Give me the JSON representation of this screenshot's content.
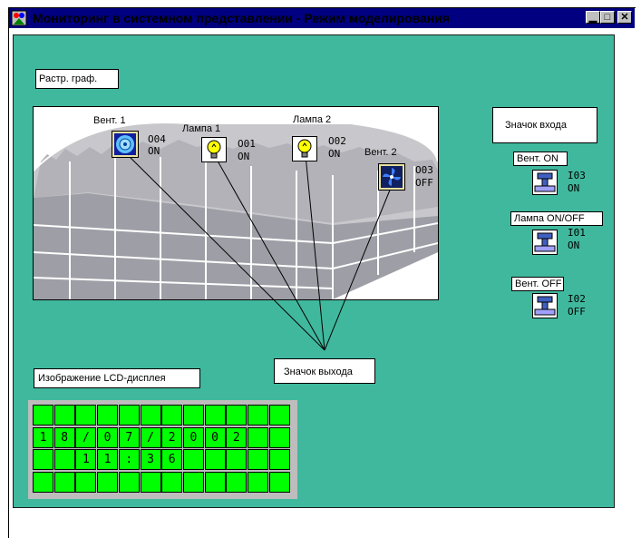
{
  "window": {
    "title": "Мониторинг в системном представлении - Режим моделирования",
    "buttons": {
      "minimize": "▁",
      "maximize": "□",
      "close": "✕"
    }
  },
  "labels": {
    "raster": "Растр. граф.",
    "input_icon": "Значок входа",
    "output_icon": "Значок выхода",
    "lcd_image": "Изображение LCD-дисплея"
  },
  "outputs": [
    {
      "name": "Вент. 1",
      "code": "O04",
      "state": "ON",
      "icon": "fan-icon"
    },
    {
      "name": "Лампа 1",
      "code": "O01",
      "state": "ON",
      "icon": "lamp-icon"
    },
    {
      "name": "Лампа 2",
      "code": "O02",
      "state": "ON",
      "icon": "lamp-icon"
    },
    {
      "name": "Вент. 2",
      "code": "O03",
      "state": "OFF",
      "icon": "fan-icon"
    }
  ],
  "inputs": [
    {
      "name": "Вент. ON",
      "code": "I03",
      "state": "ON",
      "icon": "switch-icon"
    },
    {
      "name": "Лампа ON/OFF",
      "code": "I01",
      "state": "ON",
      "icon": "switch-icon"
    },
    {
      "name": "Вент. OFF",
      "code": "I02",
      "state": "OFF",
      "icon": "switch-icon"
    }
  ],
  "lcd": {
    "rows": [
      [
        "",
        "",
        "",
        "",
        "",
        "",
        "",
        "",
        "",
        "",
        "",
        ""
      ],
      [
        "1",
        "8",
        "/",
        "0",
        "7",
        "/",
        "2",
        "0",
        "0",
        "2",
        "",
        ""
      ],
      [
        "",
        "",
        "1",
        "1",
        ":",
        "3",
        "6",
        "",
        "",
        "",
        "",
        ""
      ],
      [
        "",
        "",
        "",
        "",
        "",
        "",
        "",
        "",
        "",
        "",
        "",
        ""
      ]
    ]
  },
  "colors": {
    "titlebar": "#000080",
    "background": "#40b89d",
    "lcd_cell": "#00ff00"
  }
}
